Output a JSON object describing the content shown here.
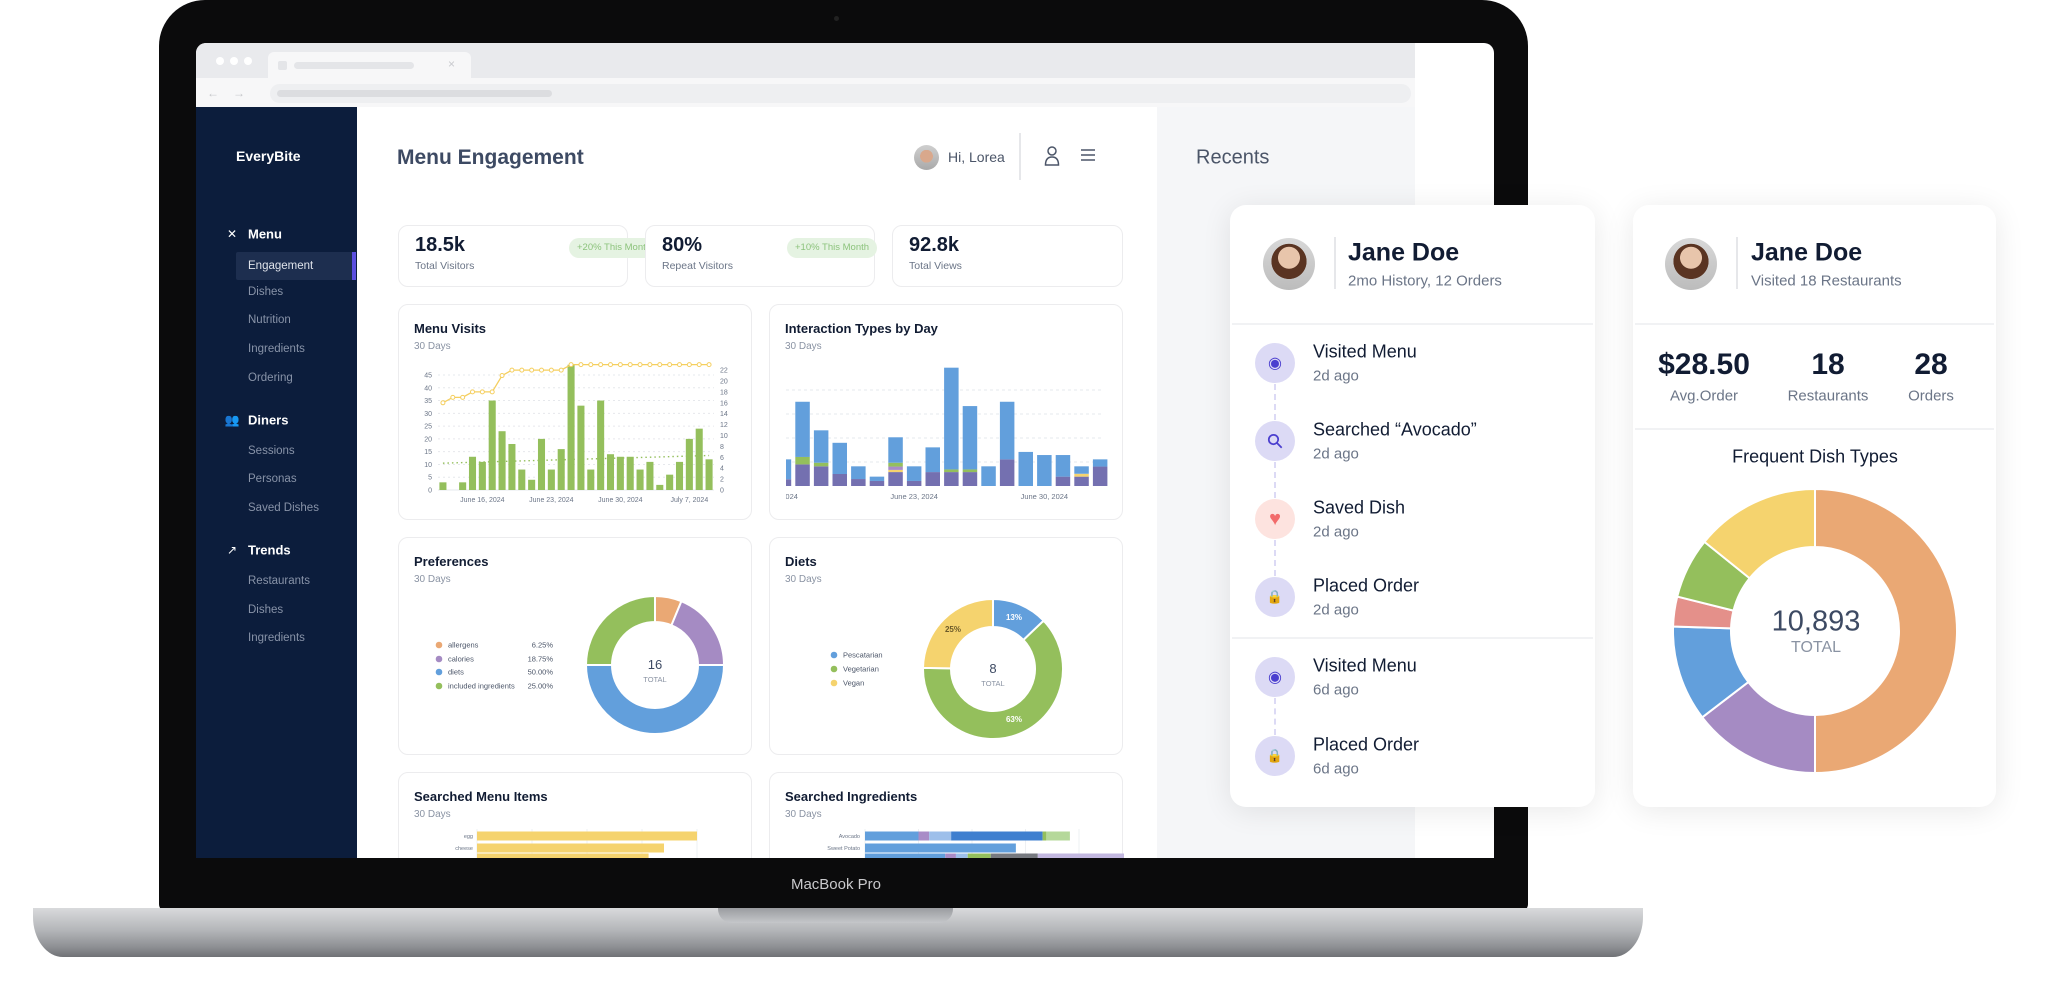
{
  "device_label": "MacBook Pro",
  "sidebar": {
    "logo": "EveryBite",
    "sections": [
      {
        "title": "Menu",
        "icon": "fork-knife-icon",
        "items": [
          "Engagement",
          "Dishes",
          "Nutrition",
          "Ingredients",
          "Ordering"
        ],
        "active": "Engagement"
      },
      {
        "title": "Diners",
        "icon": "users-icon",
        "items": [
          "Sessions",
          "Personas",
          "Saved Dishes"
        ]
      },
      {
        "title": "Trends",
        "icon": "trending-up-icon",
        "items": [
          "Restaurants",
          "Dishes",
          "Ingredients"
        ]
      }
    ],
    "accent": "#5b4fe0"
  },
  "header": {
    "title": "Menu Engagement",
    "greeting": "Hi, Lorea",
    "user_icon": "user-icon",
    "menu_icon": "hamburger-menu-icon"
  },
  "stats": [
    {
      "value": "18.5k",
      "label": "Total Visitors",
      "badge": "+20% This Month"
    },
    {
      "value": "80%",
      "label": "Repeat Visitors",
      "badge": "+10% This Month"
    },
    {
      "value": "92.8k",
      "label": "Total Views"
    }
  ],
  "recents": {
    "title": "Recents"
  },
  "activity_card": {
    "name": "Jane Doe",
    "subtitle": "2mo History, 12 Orders",
    "groups": [
      [
        {
          "title": "Visited Menu",
          "time": "2d ago",
          "icon": "eye-icon"
        },
        {
          "title": "Searched “Avocado”",
          "time": "2d ago",
          "icon": "search-icon"
        },
        {
          "title": "Saved Dish",
          "time": "2d ago",
          "icon": "heart-icon"
        },
        {
          "title": "Placed Order",
          "time": "2d ago",
          "icon": "shopping-bag-icon"
        }
      ],
      [
        {
          "title": "Visited Menu",
          "time": "6d ago",
          "icon": "eye-icon"
        },
        {
          "title": "Placed Order",
          "time": "6d ago",
          "icon": "shopping-bag-icon"
        }
      ]
    ]
  },
  "summary_card": {
    "name": "Jane Doe",
    "subtitle": "Visited 18 Restaurants",
    "stats": [
      {
        "value": "$28.50",
        "label": "Avg.Order"
      },
      {
        "value": "18",
        "label": "Restaurants"
      },
      {
        "value": "28",
        "label": "Orders"
      }
    ]
  },
  "colors": {
    "orange": "#eaa874",
    "purple": "#a58bc3",
    "blue": "#629fdc",
    "green": "#94bf5c",
    "yellow": "#f5d36e",
    "pink": "#e4908a",
    "indigo": "#7470b0",
    "navy": "#0c1d3c"
  },
  "chart_data": [
    {
      "type": "bar",
      "title": "Menu Visits",
      "subtitle": "30 Days",
      "x_tick_labels": [
        "June 16, 2024",
        "June 23, 2024",
        "June 30, 2024",
        "July 7, 2024"
      ],
      "x_tick_positions": [
        4,
        11,
        18,
        25
      ],
      "bars": [
        3,
        0,
        3,
        13,
        11,
        35,
        23,
        18,
        8,
        4,
        20,
        8,
        16,
        49,
        33,
        8,
        35,
        14,
        13,
        13,
        8,
        11,
        2,
        6,
        11,
        20,
        24,
        12
      ],
      "bar_color": "#94bf5c",
      "line": [
        16,
        17,
        17,
        18,
        18,
        18,
        21,
        22,
        22,
        22,
        22,
        22,
        22,
        23,
        23,
        23,
        23,
        23,
        23,
        23,
        23,
        23,
        23,
        23,
        23,
        23,
        23,
        23
      ],
      "line_color": "#f5cf5f",
      "trend": [
        10.5,
        13.5
      ],
      "ylim_left": [
        0,
        45
      ],
      "yticks_left": [
        0,
        5,
        10,
        15,
        20,
        25,
        30,
        35,
        40,
        45
      ],
      "ylim_right": [
        0,
        22
      ],
      "yticks_right": [
        0,
        2,
        4,
        6,
        8,
        10,
        12,
        14,
        16,
        18,
        20,
        22
      ],
      "grid": true
    },
    {
      "type": "bar",
      "stacked": true,
      "title": "Interaction Types by Day",
      "subtitle": "30 Days",
      "x_tick_labels": [
        ", 2024",
        "June 23, 2024",
        "June 30, 2024"
      ],
      "x_tick_positions": [
        0,
        7,
        14
      ],
      "grid": true,
      "series": [
        {
          "color": "#7470b0",
          "values": [
            2.8,
            9,
            8.2,
            5,
            2.9,
            2.1,
            5.8,
            2.1,
            5.8,
            5.8,
            5.8,
            0,
            11.1,
            0,
            0,
            3.9,
            3.9,
            8.1
          ]
        },
        {
          "color": "#f5d36e",
          "values": [
            0,
            0,
            0,
            0,
            0,
            0,
            0.9,
            0,
            0,
            0,
            0,
            0,
            0,
            0,
            0,
            0,
            1.2,
            0
          ]
        },
        {
          "color": "#a98cc7",
          "values": [
            0,
            0,
            0,
            0,
            0,
            0,
            1.4,
            0,
            0,
            0,
            0,
            0,
            0,
            0,
            0,
            0,
            0,
            0
          ]
        },
        {
          "color": "#94bf5c",
          "values": [
            0,
            3.1,
            1.5,
            0,
            0,
            0,
            1.6,
            0,
            0,
            1.1,
            1.1,
            0,
            0,
            0,
            0,
            0,
            0,
            0
          ]
        },
        {
          "color": "#629fdc",
          "values": [
            8.3,
            23,
            13.5,
            13,
            5.3,
            1.8,
            10.6,
            6.1,
            10.3,
            42.4,
            26.4,
            8.2,
            24,
            14.2,
            12.9,
            9,
            3.1,
            3
          ]
        }
      ]
    },
    {
      "type": "pie",
      "title": "Preferences",
      "subtitle": "30 Days",
      "total": "16",
      "total_label": "TOTAL",
      "slices": [
        {
          "label": "allergens",
          "pct": "6.25%",
          "value": 6.25,
          "color": "#eaa874"
        },
        {
          "label": "calories",
          "pct": "18.75%",
          "value": 18.75,
          "color": "#a58bc3"
        },
        {
          "label": "diets",
          "pct": "50.00%",
          "value": 50,
          "color": "#629fdc"
        },
        {
          "label": "included ingredients",
          "pct": "25.00%",
          "value": 25,
          "color": "#94bf5c"
        }
      ],
      "legend": "left"
    },
    {
      "type": "pie",
      "title": "Diets",
      "subtitle": "30 Days",
      "total": "8",
      "total_label": "TOTAL",
      "slices": [
        {
          "label": "Pescatarian",
          "pct": "13%",
          "value": 13,
          "color": "#629fdc"
        },
        {
          "label": "Vegetarian",
          "pct": "63%",
          "value": 63,
          "color": "#94bf5c"
        },
        {
          "label": "Vegan",
          "pct": "25%",
          "value": 25,
          "color": "#f5d36e"
        }
      ],
      "legend": "left"
    },
    {
      "type": "bar",
      "orientation": "horizontal",
      "title": "Searched Menu Items",
      "subtitle": "30 Days",
      "categories": [
        "egg",
        "cheese",
        ""
      ],
      "values": [
        20,
        17,
        15.6
      ],
      "color": "#f5d36e"
    },
    {
      "type": "bar",
      "orientation": "horizontal",
      "stacked": true,
      "title": "Searched Ingredients",
      "subtitle": "30 Days",
      "categories": [
        "Avocado",
        "Sweet Potato",
        ""
      ],
      "rows": [
        [
          {
            "v": 10,
            "c": "#629fdc"
          },
          {
            "v": 2,
            "c": "#a98cc7"
          },
          {
            "v": 4.1,
            "c": "#9dbfea"
          },
          {
            "v": 17.1,
            "c": "#3f7fcf"
          },
          {
            "v": 0.7,
            "c": "#94bf5c"
          },
          {
            "v": 4.4,
            "c": "#b5d89a"
          }
        ],
        [
          {
            "v": 28.2,
            "c": "#629fdc"
          }
        ],
        [
          {
            "v": 15,
            "c": "#629fdc"
          },
          {
            "v": 2,
            "c": "#a98cc7"
          },
          {
            "v": 2.2,
            "c": "#9dbfea"
          },
          {
            "v": 4.3,
            "c": "#94bf5c"
          },
          {
            "v": 8.8,
            "c": "#777a80"
          },
          {
            "v": 21.7,
            "c": "#c3b8e0"
          }
        ]
      ]
    },
    {
      "type": "pie",
      "title": "Frequent Dish Types",
      "total": "10,893",
      "total_label": "TOTAL",
      "slices": [
        {
          "value": 50,
          "color": "#eaa874"
        },
        {
          "value": 14.6,
          "color": "#a58bc3"
        },
        {
          "value": 10.9,
          "color": "#629fdc"
        },
        {
          "value": 3.4,
          "color": "#e4908a"
        },
        {
          "value": 6.9,
          "color": "#94bf5c"
        },
        {
          "value": 14.2,
          "color": "#f5d36e"
        }
      ]
    }
  ]
}
